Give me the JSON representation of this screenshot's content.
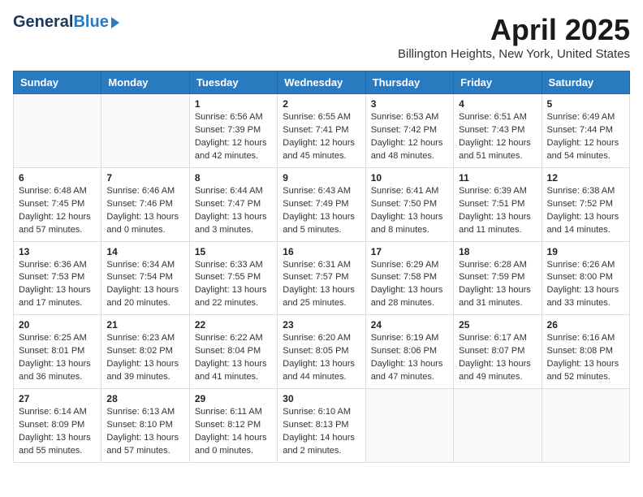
{
  "header": {
    "logo_general": "General",
    "logo_blue": "Blue",
    "title": "April 2025",
    "subtitle": "Billington Heights, New York, United States"
  },
  "weekdays": [
    "Sunday",
    "Monday",
    "Tuesday",
    "Wednesday",
    "Thursday",
    "Friday",
    "Saturday"
  ],
  "weeks": [
    [
      {
        "num": "",
        "empty": true
      },
      {
        "num": "",
        "empty": true
      },
      {
        "num": "1",
        "sunrise": "6:56 AM",
        "sunset": "7:39 PM",
        "daylight": "12 hours and 42 minutes."
      },
      {
        "num": "2",
        "sunrise": "6:55 AM",
        "sunset": "7:41 PM",
        "daylight": "12 hours and 45 minutes."
      },
      {
        "num": "3",
        "sunrise": "6:53 AM",
        "sunset": "7:42 PM",
        "daylight": "12 hours and 48 minutes."
      },
      {
        "num": "4",
        "sunrise": "6:51 AM",
        "sunset": "7:43 PM",
        "daylight": "12 hours and 51 minutes."
      },
      {
        "num": "5",
        "sunrise": "6:49 AM",
        "sunset": "7:44 PM",
        "daylight": "12 hours and 54 minutes."
      }
    ],
    [
      {
        "num": "6",
        "sunrise": "6:48 AM",
        "sunset": "7:45 PM",
        "daylight": "12 hours and 57 minutes."
      },
      {
        "num": "7",
        "sunrise": "6:46 AM",
        "sunset": "7:46 PM",
        "daylight": "13 hours and 0 minutes."
      },
      {
        "num": "8",
        "sunrise": "6:44 AM",
        "sunset": "7:47 PM",
        "daylight": "13 hours and 3 minutes."
      },
      {
        "num": "9",
        "sunrise": "6:43 AM",
        "sunset": "7:49 PM",
        "daylight": "13 hours and 5 minutes."
      },
      {
        "num": "10",
        "sunrise": "6:41 AM",
        "sunset": "7:50 PM",
        "daylight": "13 hours and 8 minutes."
      },
      {
        "num": "11",
        "sunrise": "6:39 AM",
        "sunset": "7:51 PM",
        "daylight": "13 hours and 11 minutes."
      },
      {
        "num": "12",
        "sunrise": "6:38 AM",
        "sunset": "7:52 PM",
        "daylight": "13 hours and 14 minutes."
      }
    ],
    [
      {
        "num": "13",
        "sunrise": "6:36 AM",
        "sunset": "7:53 PM",
        "daylight": "13 hours and 17 minutes."
      },
      {
        "num": "14",
        "sunrise": "6:34 AM",
        "sunset": "7:54 PM",
        "daylight": "13 hours and 20 minutes."
      },
      {
        "num": "15",
        "sunrise": "6:33 AM",
        "sunset": "7:55 PM",
        "daylight": "13 hours and 22 minutes."
      },
      {
        "num": "16",
        "sunrise": "6:31 AM",
        "sunset": "7:57 PM",
        "daylight": "13 hours and 25 minutes."
      },
      {
        "num": "17",
        "sunrise": "6:29 AM",
        "sunset": "7:58 PM",
        "daylight": "13 hours and 28 minutes."
      },
      {
        "num": "18",
        "sunrise": "6:28 AM",
        "sunset": "7:59 PM",
        "daylight": "13 hours and 31 minutes."
      },
      {
        "num": "19",
        "sunrise": "6:26 AM",
        "sunset": "8:00 PM",
        "daylight": "13 hours and 33 minutes."
      }
    ],
    [
      {
        "num": "20",
        "sunrise": "6:25 AM",
        "sunset": "8:01 PM",
        "daylight": "13 hours and 36 minutes."
      },
      {
        "num": "21",
        "sunrise": "6:23 AM",
        "sunset": "8:02 PM",
        "daylight": "13 hours and 39 minutes."
      },
      {
        "num": "22",
        "sunrise": "6:22 AM",
        "sunset": "8:04 PM",
        "daylight": "13 hours and 41 minutes."
      },
      {
        "num": "23",
        "sunrise": "6:20 AM",
        "sunset": "8:05 PM",
        "daylight": "13 hours and 44 minutes."
      },
      {
        "num": "24",
        "sunrise": "6:19 AM",
        "sunset": "8:06 PM",
        "daylight": "13 hours and 47 minutes."
      },
      {
        "num": "25",
        "sunrise": "6:17 AM",
        "sunset": "8:07 PM",
        "daylight": "13 hours and 49 minutes."
      },
      {
        "num": "26",
        "sunrise": "6:16 AM",
        "sunset": "8:08 PM",
        "daylight": "13 hours and 52 minutes."
      }
    ],
    [
      {
        "num": "27",
        "sunrise": "6:14 AM",
        "sunset": "8:09 PM",
        "daylight": "13 hours and 55 minutes."
      },
      {
        "num": "28",
        "sunrise": "6:13 AM",
        "sunset": "8:10 PM",
        "daylight": "13 hours and 57 minutes."
      },
      {
        "num": "29",
        "sunrise": "6:11 AM",
        "sunset": "8:12 PM",
        "daylight": "14 hours and 0 minutes."
      },
      {
        "num": "30",
        "sunrise": "6:10 AM",
        "sunset": "8:13 PM",
        "daylight": "14 hours and 2 minutes."
      },
      {
        "num": "",
        "empty": true
      },
      {
        "num": "",
        "empty": true
      },
      {
        "num": "",
        "empty": true
      }
    ]
  ],
  "labels": {
    "sunrise": "Sunrise:",
    "sunset": "Sunset:",
    "daylight": "Daylight:"
  }
}
